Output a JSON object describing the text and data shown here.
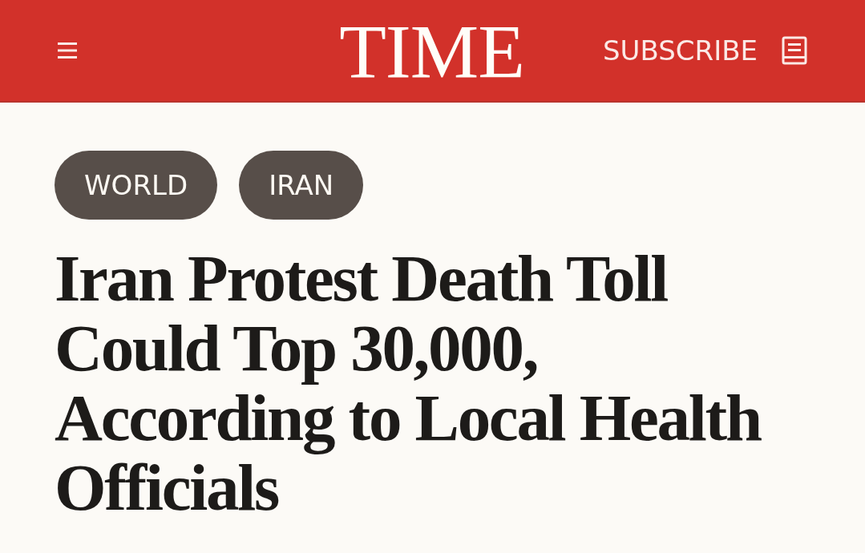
{
  "header": {
    "logo": "TIME",
    "subscribe_label": "SUBSCRIBE"
  },
  "tags": [
    {
      "label": "WORLD"
    },
    {
      "label": "IRAN"
    }
  ],
  "headline": "Iran Protest Death Toll Could Top 30,000, According to Local Health Officials"
}
